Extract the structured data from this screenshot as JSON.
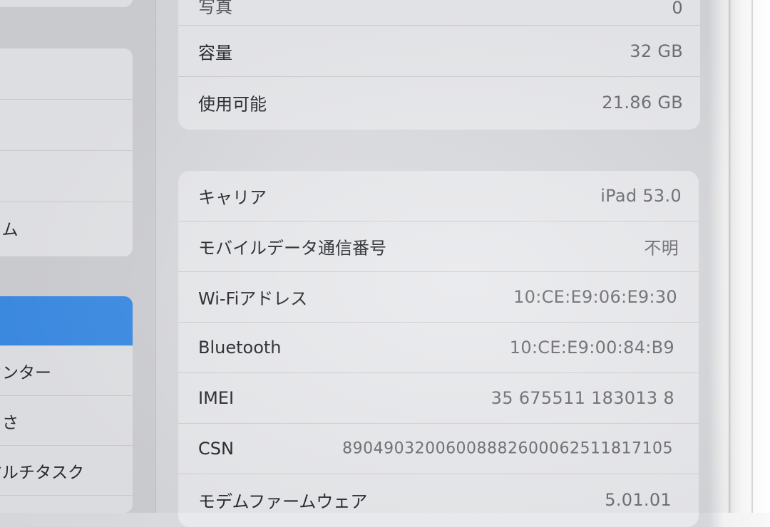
{
  "sidebar": {
    "items": [
      {
        "label": ""
      },
      {
        "label": ""
      },
      {
        "label": ""
      },
      {
        "label": "イム"
      },
      {
        "label": "",
        "selected": true
      },
      {
        "label": "センター"
      },
      {
        "label": "るさ"
      },
      {
        "label": "マルチタスク"
      },
      {
        "label": ""
      }
    ]
  },
  "storage": {
    "rows": [
      {
        "key": "写真",
        "value": "0"
      },
      {
        "key": "容量",
        "value": "32 GB"
      },
      {
        "key": "使用可能",
        "value": "21.86 GB"
      }
    ]
  },
  "network": {
    "rows": [
      {
        "key": "キャリア",
        "value": "iPad 53.0"
      },
      {
        "key": "モバイルデータ通信番号",
        "value": "不明"
      },
      {
        "key": "Wi-Fiアドレス",
        "value": "10:CE:E9:06:E9:30"
      },
      {
        "key": "Bluetooth",
        "value": "10:CE:E9:00:84:B9"
      },
      {
        "key": "IMEI",
        "value": "35 675511 183013 8"
      },
      {
        "key": "CSN",
        "value": "89049032006008882600062511817105"
      },
      {
        "key": "モデムファームウェア",
        "value": "5.01.01"
      }
    ]
  },
  "colors": {
    "selected": "#3d8de6",
    "cell_bg": "#e8e9ec",
    "background": "#d5d6da"
  }
}
